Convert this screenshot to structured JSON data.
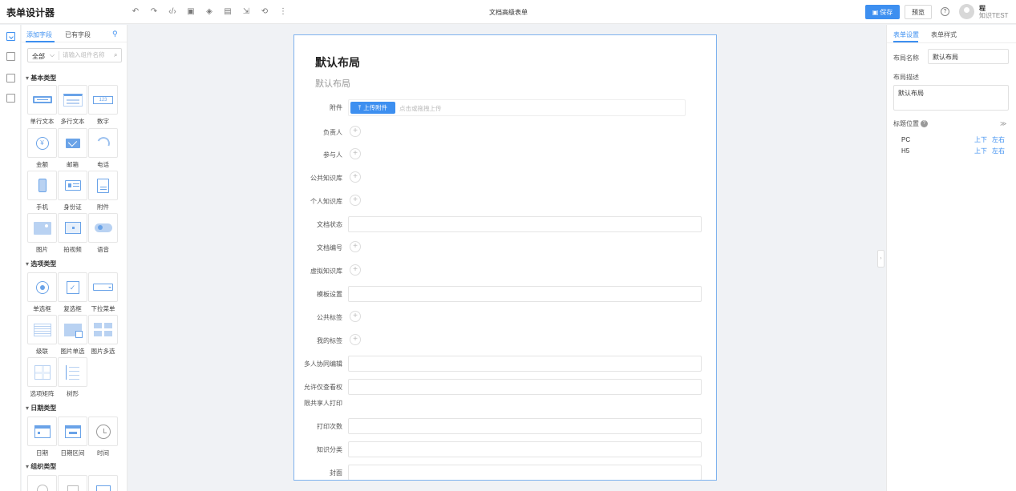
{
  "app": {
    "title": "表单设计器",
    "doc_title": "文档高级表单"
  },
  "toolbar": {
    "icons": [
      "undo-icon",
      "redo-icon",
      "code-icon",
      "image-icon",
      "layers-icon",
      "save-disk-icon",
      "export-icon",
      "history-icon",
      "more-icon"
    ],
    "glyphs": [
      "↶",
      "↷",
      "‹/›",
      "▣",
      "◈",
      "▤",
      "⇲",
      "⟲",
      "⋮"
    ]
  },
  "header": {
    "save_label": "保存",
    "preview_label": "预览",
    "help_glyph": "?",
    "user_name": "程",
    "user_org": "知识TEST"
  },
  "left_panel": {
    "tabs": [
      "添加字段",
      "已有字段"
    ],
    "filter_select": "全部",
    "search_placeholder": "请输入组件名称",
    "categories": [
      "基本类型",
      "选项类型",
      "日期类型",
      "组织类型"
    ],
    "basic": [
      "单行文本",
      "多行文本",
      "数字",
      "金额",
      "邮箱",
      "电话",
      "手机",
      "身份证",
      "附件",
      "图片",
      "拍视频",
      "语音"
    ],
    "number_glyph": "123",
    "money_glyph": "¥",
    "check_glyph": "✓",
    "options": [
      "单选框",
      "复选框",
      "下拉菜单",
      "级联",
      "图片单选",
      "图片多选",
      "选项矩阵",
      "树形"
    ],
    "dates": [
      "日期",
      "日期区间",
      "时间"
    ]
  },
  "form": {
    "title": "默认布局",
    "description": "默认布局",
    "attachment_label": "附件",
    "upload_button": "上传附件",
    "upload_hint": "点击或拖拽上传",
    "fields": [
      "负责人",
      "参与人",
      "公共知识库",
      "个人知识库",
      "文档状态",
      "文档编号",
      "虚拟知识库",
      "模板设置",
      "公共标签",
      "我的标签",
      "多人协同编辑",
      "允许仅查看权",
      "限共享人打印",
      "打印次数",
      "知识分类",
      "封面"
    ]
  },
  "right_panel": {
    "tabs": [
      "表单设置",
      "表单样式"
    ],
    "layout_name_label": "布局名称",
    "layout_name_value": "默认布局",
    "layout_desc_label": "布局描述",
    "layout_desc_value": "默认布局",
    "label_position": "标题位置",
    "rows": [
      {
        "device": "PC",
        "opt1": "上下",
        "opt2": "左右"
      },
      {
        "device": "H5",
        "opt1": "上下",
        "opt2": "左右"
      }
    ]
  },
  "colors": {
    "accent": "#3d8ff0",
    "selected_border": "#7eb2ee",
    "icon_blue": "#6aa3e8"
  }
}
